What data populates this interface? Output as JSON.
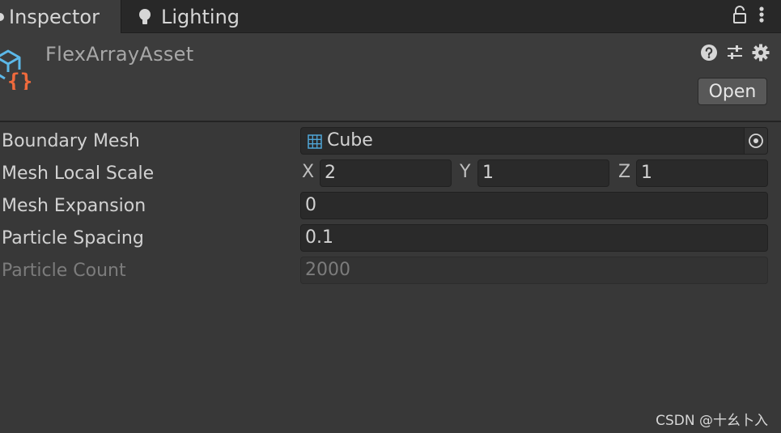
{
  "tabs": {
    "active": {
      "label": "Inspector"
    },
    "other": {
      "label": "Lighting"
    }
  },
  "asset": {
    "title": "FlexArrayAsset",
    "open_label": "Open"
  },
  "properties": {
    "boundary_mesh": {
      "label": "Boundary Mesh",
      "value": "Cube"
    },
    "mesh_local_scale": {
      "label": "Mesh Local Scale",
      "x_label": "X",
      "x": "2",
      "y_label": "Y",
      "y": "1",
      "z_label": "Z",
      "z": "1"
    },
    "mesh_expansion": {
      "label": "Mesh Expansion",
      "value": "0"
    },
    "particle_spacing": {
      "label": "Particle Spacing",
      "value": "0.1"
    },
    "particle_count": {
      "label": "Particle Count",
      "value": "2000"
    }
  },
  "watermark": "CSDN @十幺卜入",
  "icons": {
    "tab_dot": "circle-dot-icon",
    "lighting": "lightbulb-icon",
    "lock": "lock-icon",
    "menu": "vertical-ellipsis-icon",
    "asset": "scriptable-asset-icon",
    "help": "help-icon",
    "presets": "sliders-icon",
    "settings": "gear-icon",
    "mesh": "mesh-grid-icon",
    "picker": "object-picker-icon"
  },
  "colors": {
    "asset_icon_cube": "#5cb8e8",
    "asset_icon_braces": "#f06a3c",
    "mesh_icon": "#4fa6d8"
  }
}
